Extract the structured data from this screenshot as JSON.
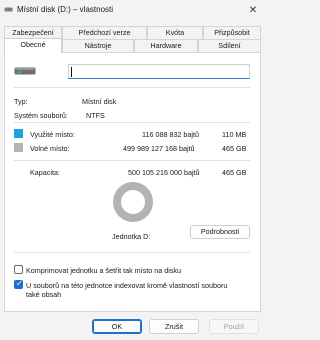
{
  "window": {
    "title": "Místní disk (D:) – vlastnosti",
    "close_icon": "close-icon"
  },
  "tabs": {
    "row1": [
      "Zabezpečení",
      "Předchozí verze",
      "Kvóta",
      "Přizpůsobit"
    ],
    "row2": [
      "Obecné",
      "Nástroje",
      "Hardware",
      "Sdílení"
    ],
    "active": "Obecné"
  },
  "general": {
    "drive_icon": "drive-icon",
    "name_value": "",
    "type_label": "Typ:",
    "type_value": "Místní disk",
    "fs_label": "Systém souborů:",
    "fs_value": "NTFS",
    "used_label": "Využité místo:",
    "used_bytes": "116 088 832 bajtů",
    "used_size": "110 MB",
    "free_label": "Volné místo:",
    "free_bytes": "499 989 127 168 bajtů",
    "free_size": "465 GB",
    "capacity_label": "Kapacita:",
    "capacity_bytes": "500 105 216 000 bajtů",
    "capacity_size": "465 GB",
    "drive_label": "Jednotka D:",
    "details_button": "Podrobnosti",
    "used_fraction": 0.0002,
    "colors": {
      "used": "#1fa0e0",
      "free": "#b3b3b3"
    }
  },
  "options": {
    "compress_label": "Komprimovat jednotku a šetřit tak místo na disku",
    "compress_checked": false,
    "index_label_line1": "U souborů na této jednotce indexovat kromě vlastností souboru",
    "index_label_line2": "také obsah",
    "index_checked": true
  },
  "buttons": {
    "ok": "OK",
    "cancel": "Zrušit",
    "apply": "Použít"
  }
}
